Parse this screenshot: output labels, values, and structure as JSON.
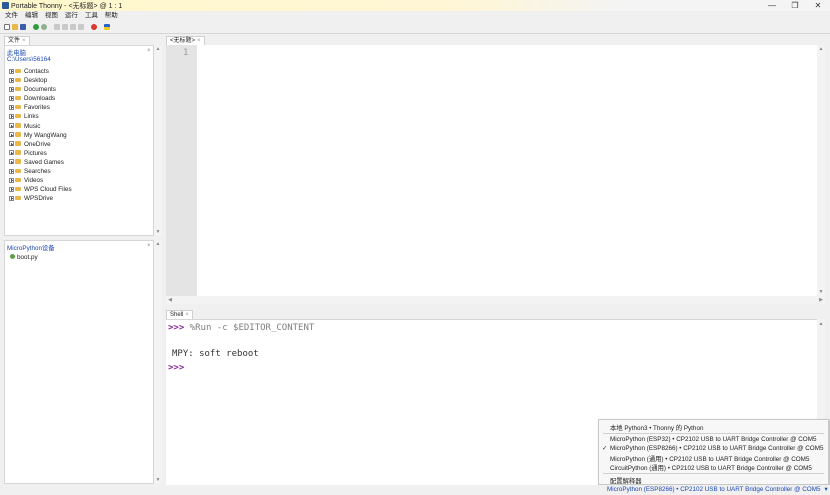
{
  "window": {
    "title": "Portable Thonny  -  <无标题>  @  1 : 1",
    "minimize_icon": "minimize-icon",
    "maximize_icon": "restore-icon",
    "close_icon": "close-icon",
    "min_glyph": "—",
    "max_glyph": "❐",
    "close_glyph": "✕"
  },
  "menu": [
    "文件",
    "编辑",
    "视图",
    "运行",
    "工具",
    "帮助"
  ],
  "toolbar": {
    "icons": [
      "new-file-icon",
      "open-file-icon",
      "save-icon",
      "run-icon",
      "debug-icon",
      "step-over-icon",
      "step-into-icon",
      "step-out-icon",
      "resume-icon",
      "stop-icon",
      "flag-icon"
    ]
  },
  "files_panel": {
    "tab_label": "文件",
    "tab_close": "×",
    "location_title": "此电脑",
    "path": "C:\\Users\\56164",
    "close_glyph": "×",
    "folders": [
      "Contacts",
      "Desktop",
      "Documents",
      "Downloads",
      "Favorites",
      "Links",
      "Music",
      "My WangWang",
      "OneDrive",
      "Pictures",
      "Saved Games",
      "Searches",
      "Videos",
      "WPS Cloud Files",
      "WPSDrive"
    ]
  },
  "device_panel": {
    "title": "MicroPython设备",
    "close_glyph": "×",
    "files": [
      "boot.py"
    ]
  },
  "editor": {
    "tab_label": "<无标题>",
    "tab_close": "×",
    "line_numbers": [
      "1"
    ]
  },
  "shell": {
    "tab_label": "Shell",
    "tab_close": "×",
    "lines": [
      {
        "prompt": ">>>",
        "text": " %Run -c $EDITOR_CONTENT"
      },
      {
        "prompt": "",
        "text": ""
      },
      {
        "prompt": "",
        "text": "MPY: soft reboot"
      },
      {
        "prompt": ">>>",
        "text": ""
      }
    ]
  },
  "interpreter_menu": {
    "items": [
      {
        "label": "本地 Python3  •  Thonny 的 Python",
        "checked": false
      },
      {
        "label": "MicroPython (ESP32)  •  CP2102 USB to UART Bridge Controller @ COM5",
        "checked": false
      },
      {
        "label": "MicroPython (ESP8266)  •  CP2102 USB to UART Bridge Controller @ COM5",
        "checked": true
      },
      {
        "label": "MicroPython (通用)  •  CP2102 USB to UART Bridge Controller @ COM5",
        "checked": false
      },
      {
        "label": "CircuitPython (通用)  •  CP2102 USB to UART Bridge Controller @ COM5",
        "checked": false
      },
      {
        "label": "配置解释器",
        "checked": false
      }
    ],
    "check_glyph": "✓"
  },
  "statusbar": {
    "interpreter": "MicroPython (ESP8266)  •  CP2102 USB to UART Bridge Controller @ COM5",
    "dropdown_glyph": "▾"
  },
  "colors": {
    "accent_blue": "#1a47b3",
    "prompt_purple": "#8a1f9c",
    "shell_text": "#7f7f7f",
    "stop_red": "#d83a2e",
    "run_green": "#2e9e3a"
  }
}
